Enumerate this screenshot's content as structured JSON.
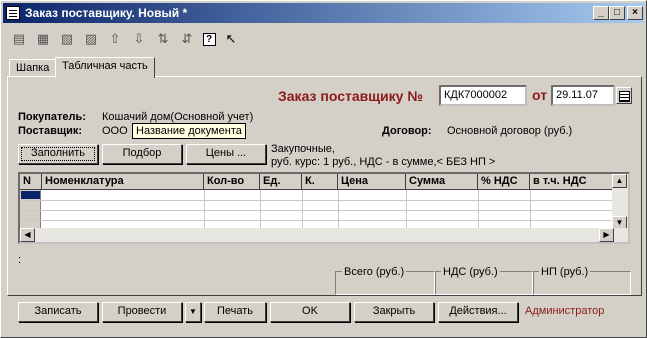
{
  "window": {
    "title": "Заказ поставщику. Новый *",
    "controls": {
      "minimize": "_",
      "maximize": "□",
      "close": "×"
    }
  },
  "toolbar": {
    "icons": [
      "new-icon",
      "copy-icon",
      "edit-icon",
      "delete-icon",
      "move-up-icon",
      "move-down-icon",
      "sort-asc-icon",
      "sort-desc-icon",
      "help-icon",
      "whats-this-icon"
    ]
  },
  "tabs": [
    {
      "label": "Шапка",
      "active": false
    },
    {
      "label": "Табличная часть",
      "active": true
    }
  ],
  "header": {
    "doc_title": "Заказ поставщику №",
    "doc_number": "КДК7000002",
    "date_label": "от",
    "date": "29.11.07",
    "buyer_label": "Покупатель:",
    "buyer_value": "Кошачий дом(Основной учет)",
    "supplier_label": "Поставщик:",
    "supplier_value": "ООО",
    "contract_label": "Договор:",
    "contract_value": "Основной договор (руб.)",
    "tooltip": "Название документа"
  },
  "actions": {
    "fill": "Заполнить",
    "select": "Подбор",
    "prices": "Цены ...",
    "price_info_line1": "Закупочные,",
    "price_info_line2": "руб. курс: 1 руб., НДС - в сумме,< БЕЗ НП >"
  },
  "table": {
    "columns": [
      "N",
      "Номенклатура",
      "Кол-во",
      "Ед.",
      "К.",
      "Цена",
      "Сумма",
      "% НДС",
      "в т.ч. НДС"
    ],
    "rows": []
  },
  "footer": {
    "colon": ":",
    "total_label": "Всего (руб.)",
    "vat_label": "НДС (руб.)",
    "np_label": "НП (руб.)",
    "buttons": {
      "save": "Записать",
      "post": "Провести",
      "dropdown": "▼",
      "print": "Печать",
      "ok": "OK",
      "close": "Закрыть",
      "actions": "Действия..."
    },
    "user": "Администратор"
  }
}
